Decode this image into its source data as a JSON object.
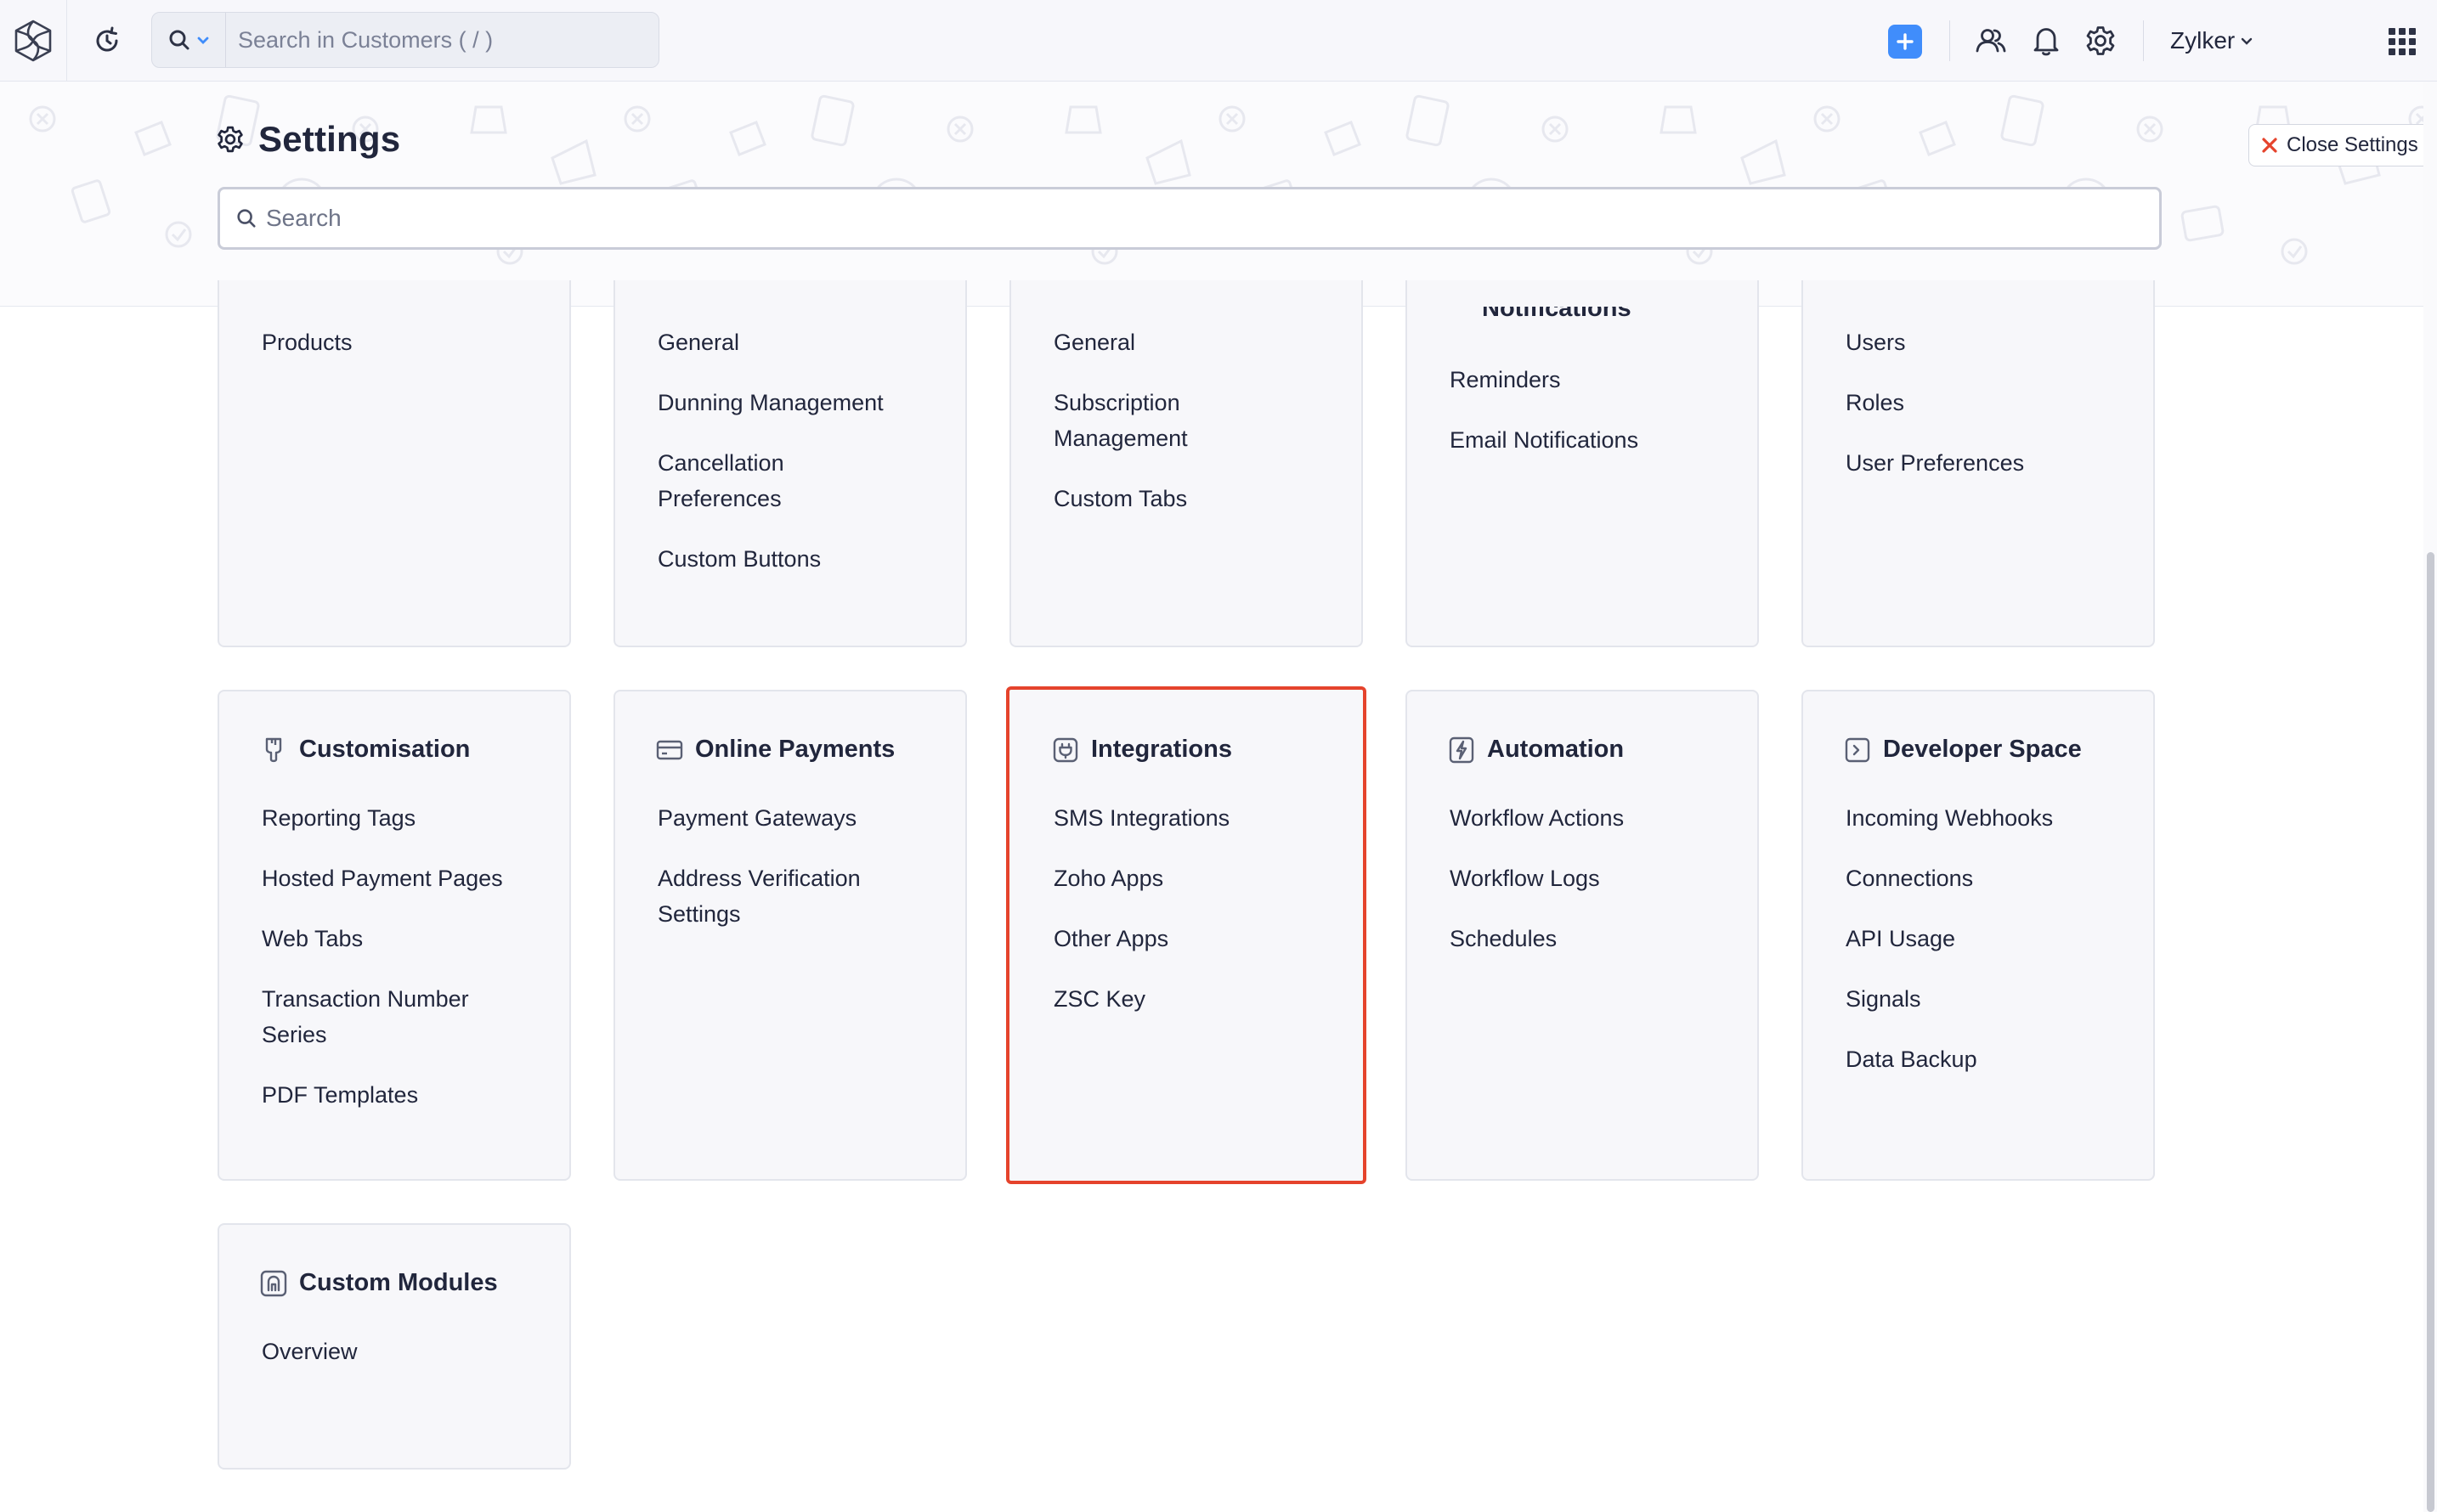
{
  "topbar": {
    "search_placeholder": "Search in Customers ( / )",
    "org_name": "Zylker",
    "icons": [
      "app-logo-icon",
      "recent-history-icon",
      "search-icon",
      "chevron-down-icon",
      "plus-icon",
      "users-icon",
      "bell-icon",
      "gear-icon",
      "apps-grid-icon"
    ]
  },
  "settings": {
    "title": "Settings",
    "close_label": "Close Settings",
    "search_placeholder": "Search"
  },
  "top_row": [
    {
      "items": [
        "Products"
      ]
    },
    {
      "items": [
        "General",
        "Dunning Management",
        "Cancellation Preferences",
        "Custom Buttons"
      ]
    },
    {
      "items": [
        "General",
        "Subscription Management",
        "Custom Tabs"
      ]
    },
    {
      "partial_title": "Notifications",
      "items": [
        "Reminders",
        "Email Notifications"
      ]
    },
    {
      "items": [
        "Users",
        "Roles",
        "User Preferences"
      ]
    }
  ],
  "middle_row": [
    {
      "title": "Customisation",
      "icon": "brush-icon",
      "items": [
        "Reporting Tags",
        "Hosted Payment Pages",
        "Web Tabs",
        "Transaction Number Series",
        "PDF Templates"
      ]
    },
    {
      "title": "Online Payments",
      "icon": "credit-card-icon",
      "items": [
        "Payment Gateways",
        "Address Verification Settings"
      ]
    },
    {
      "title": "Integrations",
      "icon": "plug-icon",
      "items": [
        "SMS Integrations",
        "Zoho Apps",
        "Other Apps",
        "ZSC Key"
      ]
    },
    {
      "title": "Automation",
      "icon": "lightning-icon",
      "items": [
        "Workflow Actions",
        "Workflow Logs",
        "Schedules"
      ]
    },
    {
      "title": "Developer Space",
      "icon": "terminal-icon",
      "items": [
        "Incoming Webhooks",
        "Connections",
        "API Usage",
        "Signals",
        "Data Backup"
      ]
    }
  ],
  "bottom_row": [
    {
      "title": "Custom Modules",
      "icon": "custom-module-icon",
      "items": [
        "Overview"
      ]
    }
  ],
  "colors": {
    "accent_blue": "#408dfb",
    "highlight_red": "#e5432c",
    "card_bg": "#f7f7fa",
    "text": "#21263c"
  }
}
